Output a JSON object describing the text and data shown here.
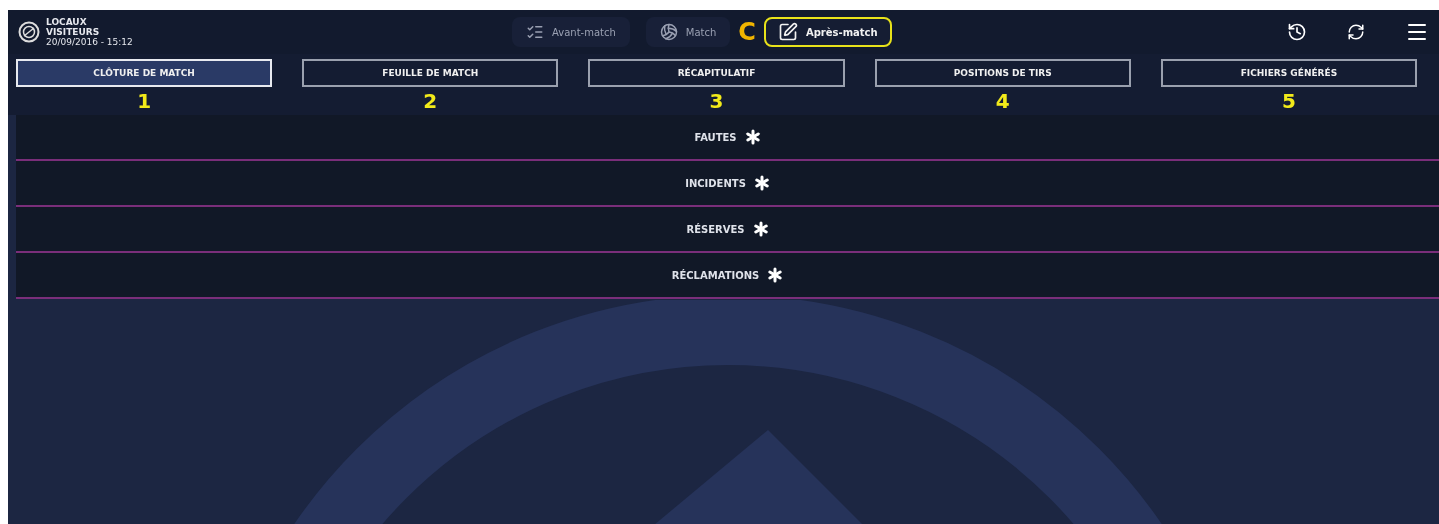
{
  "header": {
    "team_home": "LOCAUX",
    "team_away": "VISITEURS",
    "datetime": "20/09/2016 - 15:12"
  },
  "phases": [
    {
      "label": "Avant-match",
      "kind": "roster",
      "selected": false
    },
    {
      "label": "Match",
      "kind": "ball",
      "selected": false
    },
    {
      "label": "Après-match",
      "kind": "edit",
      "selected": true
    }
  ],
  "phase_marker": "C",
  "tabs": [
    {
      "label": "CLÔTURE DE MATCH",
      "selected": true,
      "number": "1"
    },
    {
      "label": "FEUILLE DE MATCH",
      "selected": false,
      "number": "2"
    },
    {
      "label": "RÉCAPITULATIF",
      "selected": false,
      "number": "3"
    },
    {
      "label": "POSITIONS DE TIRS",
      "selected": false,
      "number": "4"
    },
    {
      "label": "FICHIERS GÉNÉRÉS",
      "selected": false,
      "number": "5"
    }
  ],
  "sections": [
    {
      "label": "FAUTES",
      "required": true
    },
    {
      "label": "INCIDENTS",
      "required": true
    },
    {
      "label": "RÉSERVES",
      "required": true
    },
    {
      "label": "RÉCLAMATIONS",
      "required": true
    }
  ]
}
